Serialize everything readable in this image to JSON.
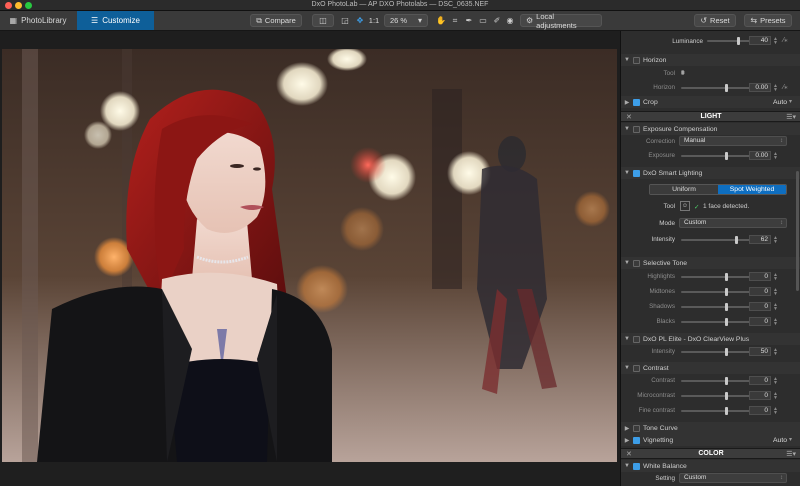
{
  "window": {
    "title": "DxO PhotoLab — AP DXO Photolabs — DSC_0635.NEF"
  },
  "toolbar": {
    "photolibrary": "PhotoLibrary",
    "customize": "Customize",
    "compare": "Compare",
    "zoom_fit": "1:1",
    "zoom_level": "26 %",
    "local_adjustments": "Local adjustments",
    "reset": "Reset",
    "presets": "Presets"
  },
  "panel": {
    "luminance": {
      "label": "Luminance",
      "value": "40",
      "fraction": 0.5
    },
    "horizon": {
      "title": "Horizon",
      "tool_label": "Tool",
      "label": "Horizon",
      "value": "0.00",
      "fraction": 0.5
    },
    "crop": {
      "title": "Crop",
      "mode": "Auto"
    },
    "light_section": "LIGHT",
    "exposure": {
      "title": "Exposure Compensation",
      "correction_label": "Correction",
      "correction_value": "Manual",
      "label": "Exposure",
      "value": "0.00",
      "fraction": 0.5
    },
    "smart_lighting": {
      "title": "DxO Smart Lighting",
      "uniform": "Uniform",
      "spot": "Spot Weighted",
      "tool_label": "Tool",
      "face_detected": "1 face detected.",
      "mode_label": "Mode",
      "mode_value": "Custom",
      "intensity_label": "Intensity",
      "intensity_value": "62",
      "intensity_fraction": 0.62
    },
    "selective_tone": {
      "title": "Selective Tone",
      "rows": [
        {
          "label": "Highlights",
          "value": "0",
          "fraction": 0.5
        },
        {
          "label": "Midtones",
          "value": "0",
          "fraction": 0.5
        },
        {
          "label": "Shadows",
          "value": "0",
          "fraction": 0.5
        },
        {
          "label": "Blacks",
          "value": "0",
          "fraction": 0.5
        }
      ]
    },
    "clearview": {
      "title": "DxO PL Elite - DxO ClearView Plus",
      "label": "Intensity",
      "value": "50",
      "fraction": 0.5
    },
    "contrast": {
      "title": "Contrast",
      "rows": [
        {
          "label": "Contrast",
          "value": "0",
          "fraction": 0.5
        },
        {
          "label": "Microcontrast",
          "value": "0",
          "fraction": 0.5
        },
        {
          "label": "Fine contrast",
          "value": "0",
          "fraction": 0.5
        }
      ]
    },
    "tone_curve": {
      "title": "Tone Curve"
    },
    "vignetting": {
      "title": "Vignetting",
      "mode": "Auto"
    },
    "color_section": "COLOR",
    "white_balance": {
      "title": "White Balance",
      "setting_label": "Setting",
      "setting_value": "Custom"
    }
  },
  "colors": {
    "accent": "#0e5f99",
    "toolbar": "#3a3a3a",
    "panel": "#2d2d2d",
    "highlight": "#3d9ee8"
  }
}
